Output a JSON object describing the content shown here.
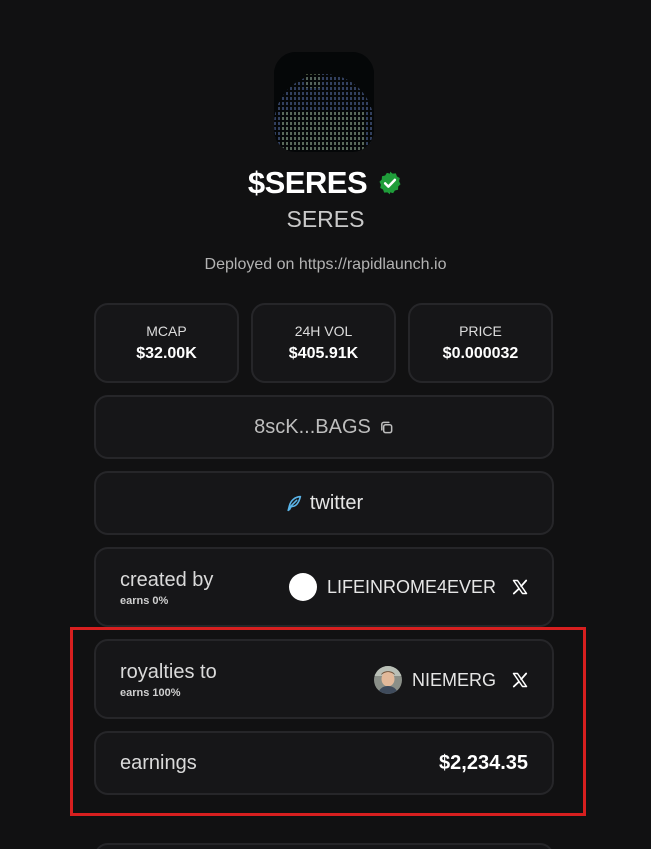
{
  "token": {
    "ticker": "$SERES",
    "name": "SERES",
    "deployed": "Deployed on https://rapidlaunch.io",
    "verified_icon": "verified-check-icon"
  },
  "stats": [
    {
      "label": "MCAP",
      "value": "$32.00K"
    },
    {
      "label": "24H VOL",
      "value": "$405.91K"
    },
    {
      "label": "PRICE",
      "value": "$0.000032"
    }
  ],
  "contract": {
    "address": "8scK...BAGS",
    "icon": "copy-icon"
  },
  "twitter": {
    "label": "twitter",
    "icon": "feather-icon"
  },
  "creator": {
    "label": "created by",
    "sub": "earns 0%",
    "username": "LIFEINROME4EVER",
    "icon": "x-logo-icon"
  },
  "royalties": {
    "label": "royalties to",
    "sub": "earns 100%",
    "username": "NIEMERG",
    "icon": "x-logo-icon"
  },
  "earnings": {
    "label": "earnings",
    "amount": "$2,234.35"
  },
  "colors": {
    "background": "#111112",
    "card": "#161618",
    "verified": "#1f9d3a",
    "highlight": "#d71f1f",
    "feather": "#5ab4e8"
  }
}
